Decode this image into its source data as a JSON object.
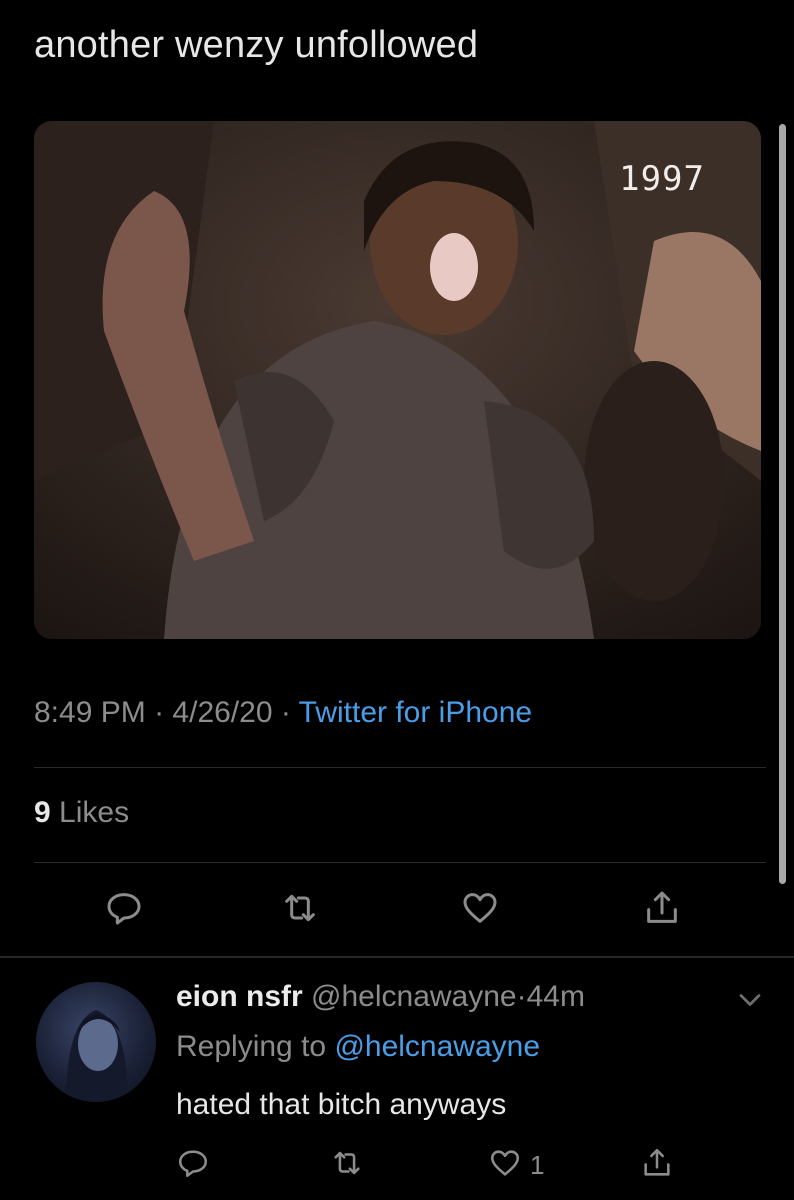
{
  "tweet": {
    "text": "another wenzy unfollowed",
    "media_caption": "1997",
    "time": "8:49 PM",
    "date": "4/26/20",
    "separator": "·",
    "source": "Twitter for iPhone",
    "likes_count": "9",
    "likes_label": "Likes",
    "actions": [
      "reply-icon",
      "retweet-icon",
      "like-icon",
      "share-icon"
    ]
  },
  "reply": {
    "name": "eion nsfr",
    "handle": "@helcnawayne",
    "separator": "·",
    "age": "44m",
    "replying_prefix": "Replying to",
    "replying_to": "@helcnawayne",
    "text": "hated that bitch anyways",
    "like_count": "1"
  },
  "colors": {
    "background": "#000000",
    "link": "#4a9ee8",
    "secondary_text": "#8c8c8c",
    "primary_text": "#e7e7e7"
  }
}
